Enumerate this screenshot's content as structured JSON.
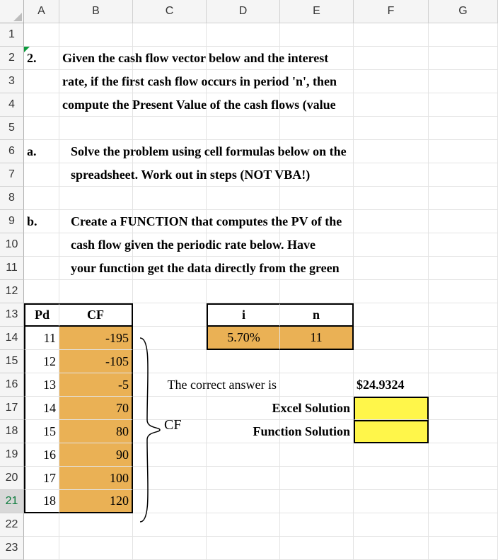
{
  "columns": [
    "A",
    "B",
    "C",
    "D",
    "E",
    "F",
    "G"
  ],
  "rows": [
    "1",
    "2",
    "3",
    "4",
    "5",
    "6",
    "7",
    "8",
    "9",
    "10",
    "11",
    "12",
    "13",
    "14",
    "15",
    "16",
    "17",
    "18",
    "19",
    "20",
    "21",
    "22",
    "23"
  ],
  "q_no": "2.",
  "q_line1": "Given the cash flow vector below and the interest",
  "q_line2": "rate, if the first cash flow occurs in period  'n',  then",
  "q_line3": "compute the Present Value of the cash flows (value",
  "a_label": "a.",
  "a_line1": "Solve the problem using cell formulas below on the",
  "a_line2": "spreadsheet.  Work out in steps (NOT VBA!)",
  "b_label": "b.",
  "b_line1": "Create a FUNCTION that computes the PV of the",
  "b_line2": "cash flow given the periodic rate below.   Have",
  "b_line3": "your function get the data directly from the green",
  "pd_hdr": "Pd",
  "cf_hdr": "CF",
  "i_hdr": "i",
  "n_hdr": "n",
  "i_val": "5.70%",
  "n_val": "11",
  "pd": [
    "11",
    "12",
    "13",
    "14",
    "15",
    "16",
    "17",
    "18"
  ],
  "cf": [
    "-195",
    "-105",
    "-5",
    "70",
    "80",
    "90",
    "100",
    "120"
  ],
  "answer_text": "The correct answer is",
  "answer_val": "$24.9324",
  "excel_sol": "Excel Solution",
  "func_sol": "Function Solution",
  "cf_brace_label": "CF"
}
